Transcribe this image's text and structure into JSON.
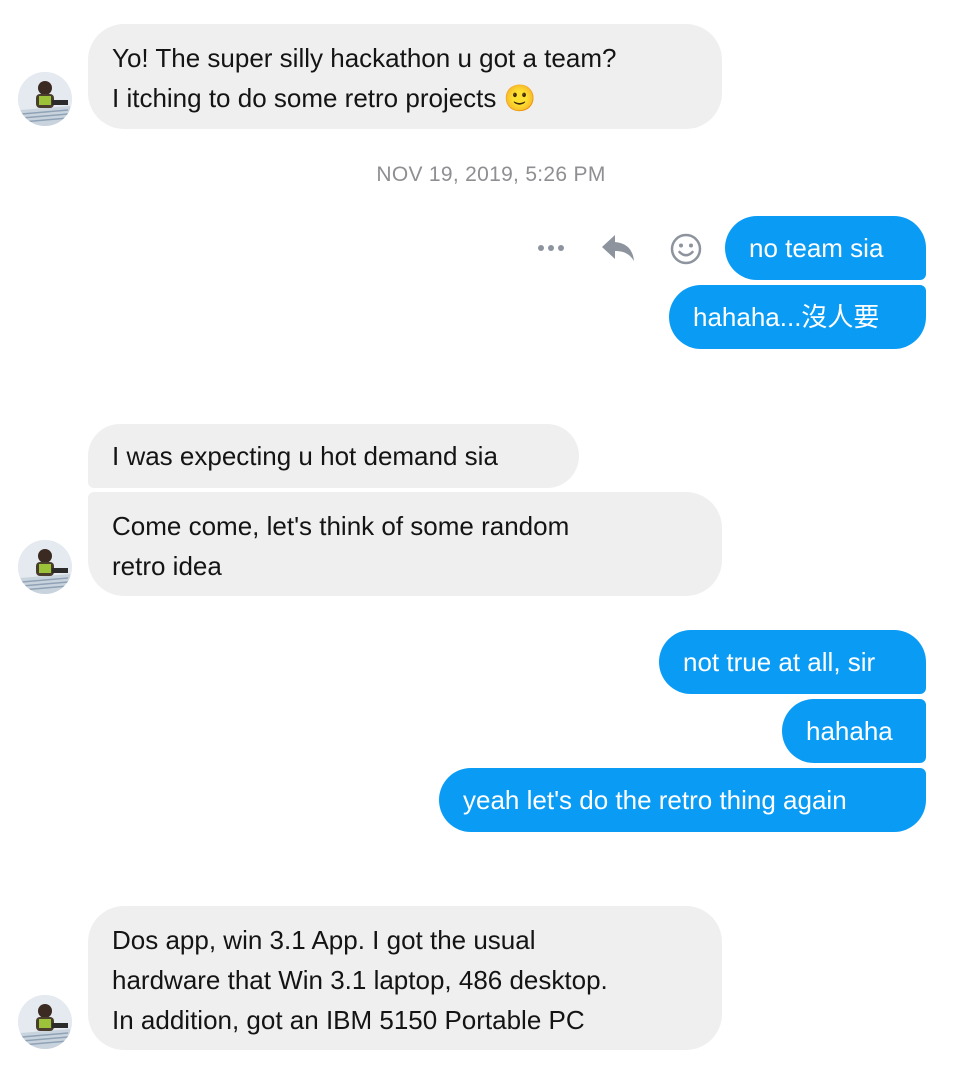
{
  "conversation": {
    "timestamp": "NOV 19, 2019, 5:26 PM",
    "messages": [
      {
        "lines": [
          "Yo! The super silly hackathon u  got a team?",
          "I itching to do some retro projects 🙂"
        ]
      },
      {
        "text": "no team sia"
      },
      {
        "text": "hahaha...沒人要"
      },
      {
        "text": "I was expecting u hot demand sia"
      },
      {
        "lines": [
          "Come come, let's think of some random",
          "retro idea"
        ]
      },
      {
        "text": "not true at all, sir"
      },
      {
        "text": "hahaha"
      },
      {
        "text": "yeah let's do the retro thing again"
      },
      {
        "lines": [
          "Dos app, win 3.1 App. I got the usual",
          "hardware that Win 3.1 laptop, 486 desktop.",
          "In addition, got an IBM 5150 Portable PC"
        ]
      }
    ]
  },
  "hover_actions": {
    "more_icon": "more-horizontal-icon",
    "reply_icon": "reply-arrow-icon",
    "react_icon": "smiley-face-icon"
  },
  "colors": {
    "incoming_bubble": "#efefef",
    "outgoing_bubble": "#0a9cf5",
    "timestamp_text": "#8e8e93",
    "action_icon": "#8d949e"
  }
}
